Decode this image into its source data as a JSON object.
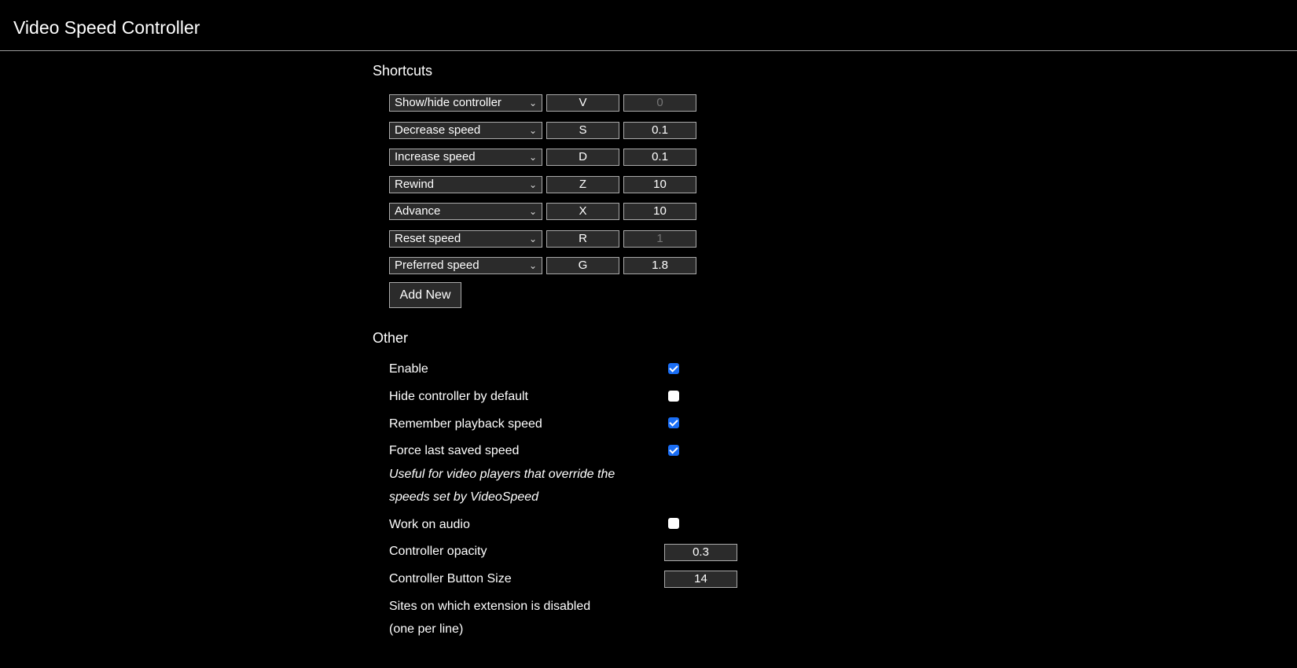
{
  "header": {
    "title": "Video Speed Controller"
  },
  "shortcuts": {
    "heading": "Shortcuts",
    "add_new_label": "Add New",
    "rows": [
      {
        "action": "Show/hide controller",
        "key": "V",
        "value": "0",
        "value_disabled": true
      },
      {
        "action": "Decrease speed",
        "key": "S",
        "value": "0.1",
        "value_disabled": false
      },
      {
        "action": "Increase speed",
        "key": "D",
        "value": "0.1",
        "value_disabled": false
      },
      {
        "action": "Rewind",
        "key": "Z",
        "value": "10",
        "value_disabled": false
      },
      {
        "action": "Advance",
        "key": "X",
        "value": "10",
        "value_disabled": false
      },
      {
        "action": "Reset speed",
        "key": "R",
        "value": "1",
        "value_disabled": true
      },
      {
        "action": "Preferred speed",
        "key": "G",
        "value": "1.8",
        "value_disabled": false
      }
    ]
  },
  "other": {
    "heading": "Other",
    "enable": {
      "label": "Enable",
      "checked": true
    },
    "hide_controller": {
      "label": "Hide controller by default",
      "checked": false
    },
    "remember_speed": {
      "label": "Remember playback speed",
      "checked": true
    },
    "force_last_saved": {
      "label": "Force last saved speed",
      "checked": true,
      "note_line1": "Useful for video players that override the",
      "note_line2": "speeds set by VideoSpeed"
    },
    "work_on_audio": {
      "label": "Work on audio",
      "checked": false
    },
    "opacity": {
      "label": "Controller opacity",
      "value": "0.3"
    },
    "button_size": {
      "label": "Controller Button Size",
      "value": "14"
    },
    "blacklist": {
      "label_line1": "Sites on which extension is disabled",
      "label_line2": "(one per line)"
    }
  }
}
